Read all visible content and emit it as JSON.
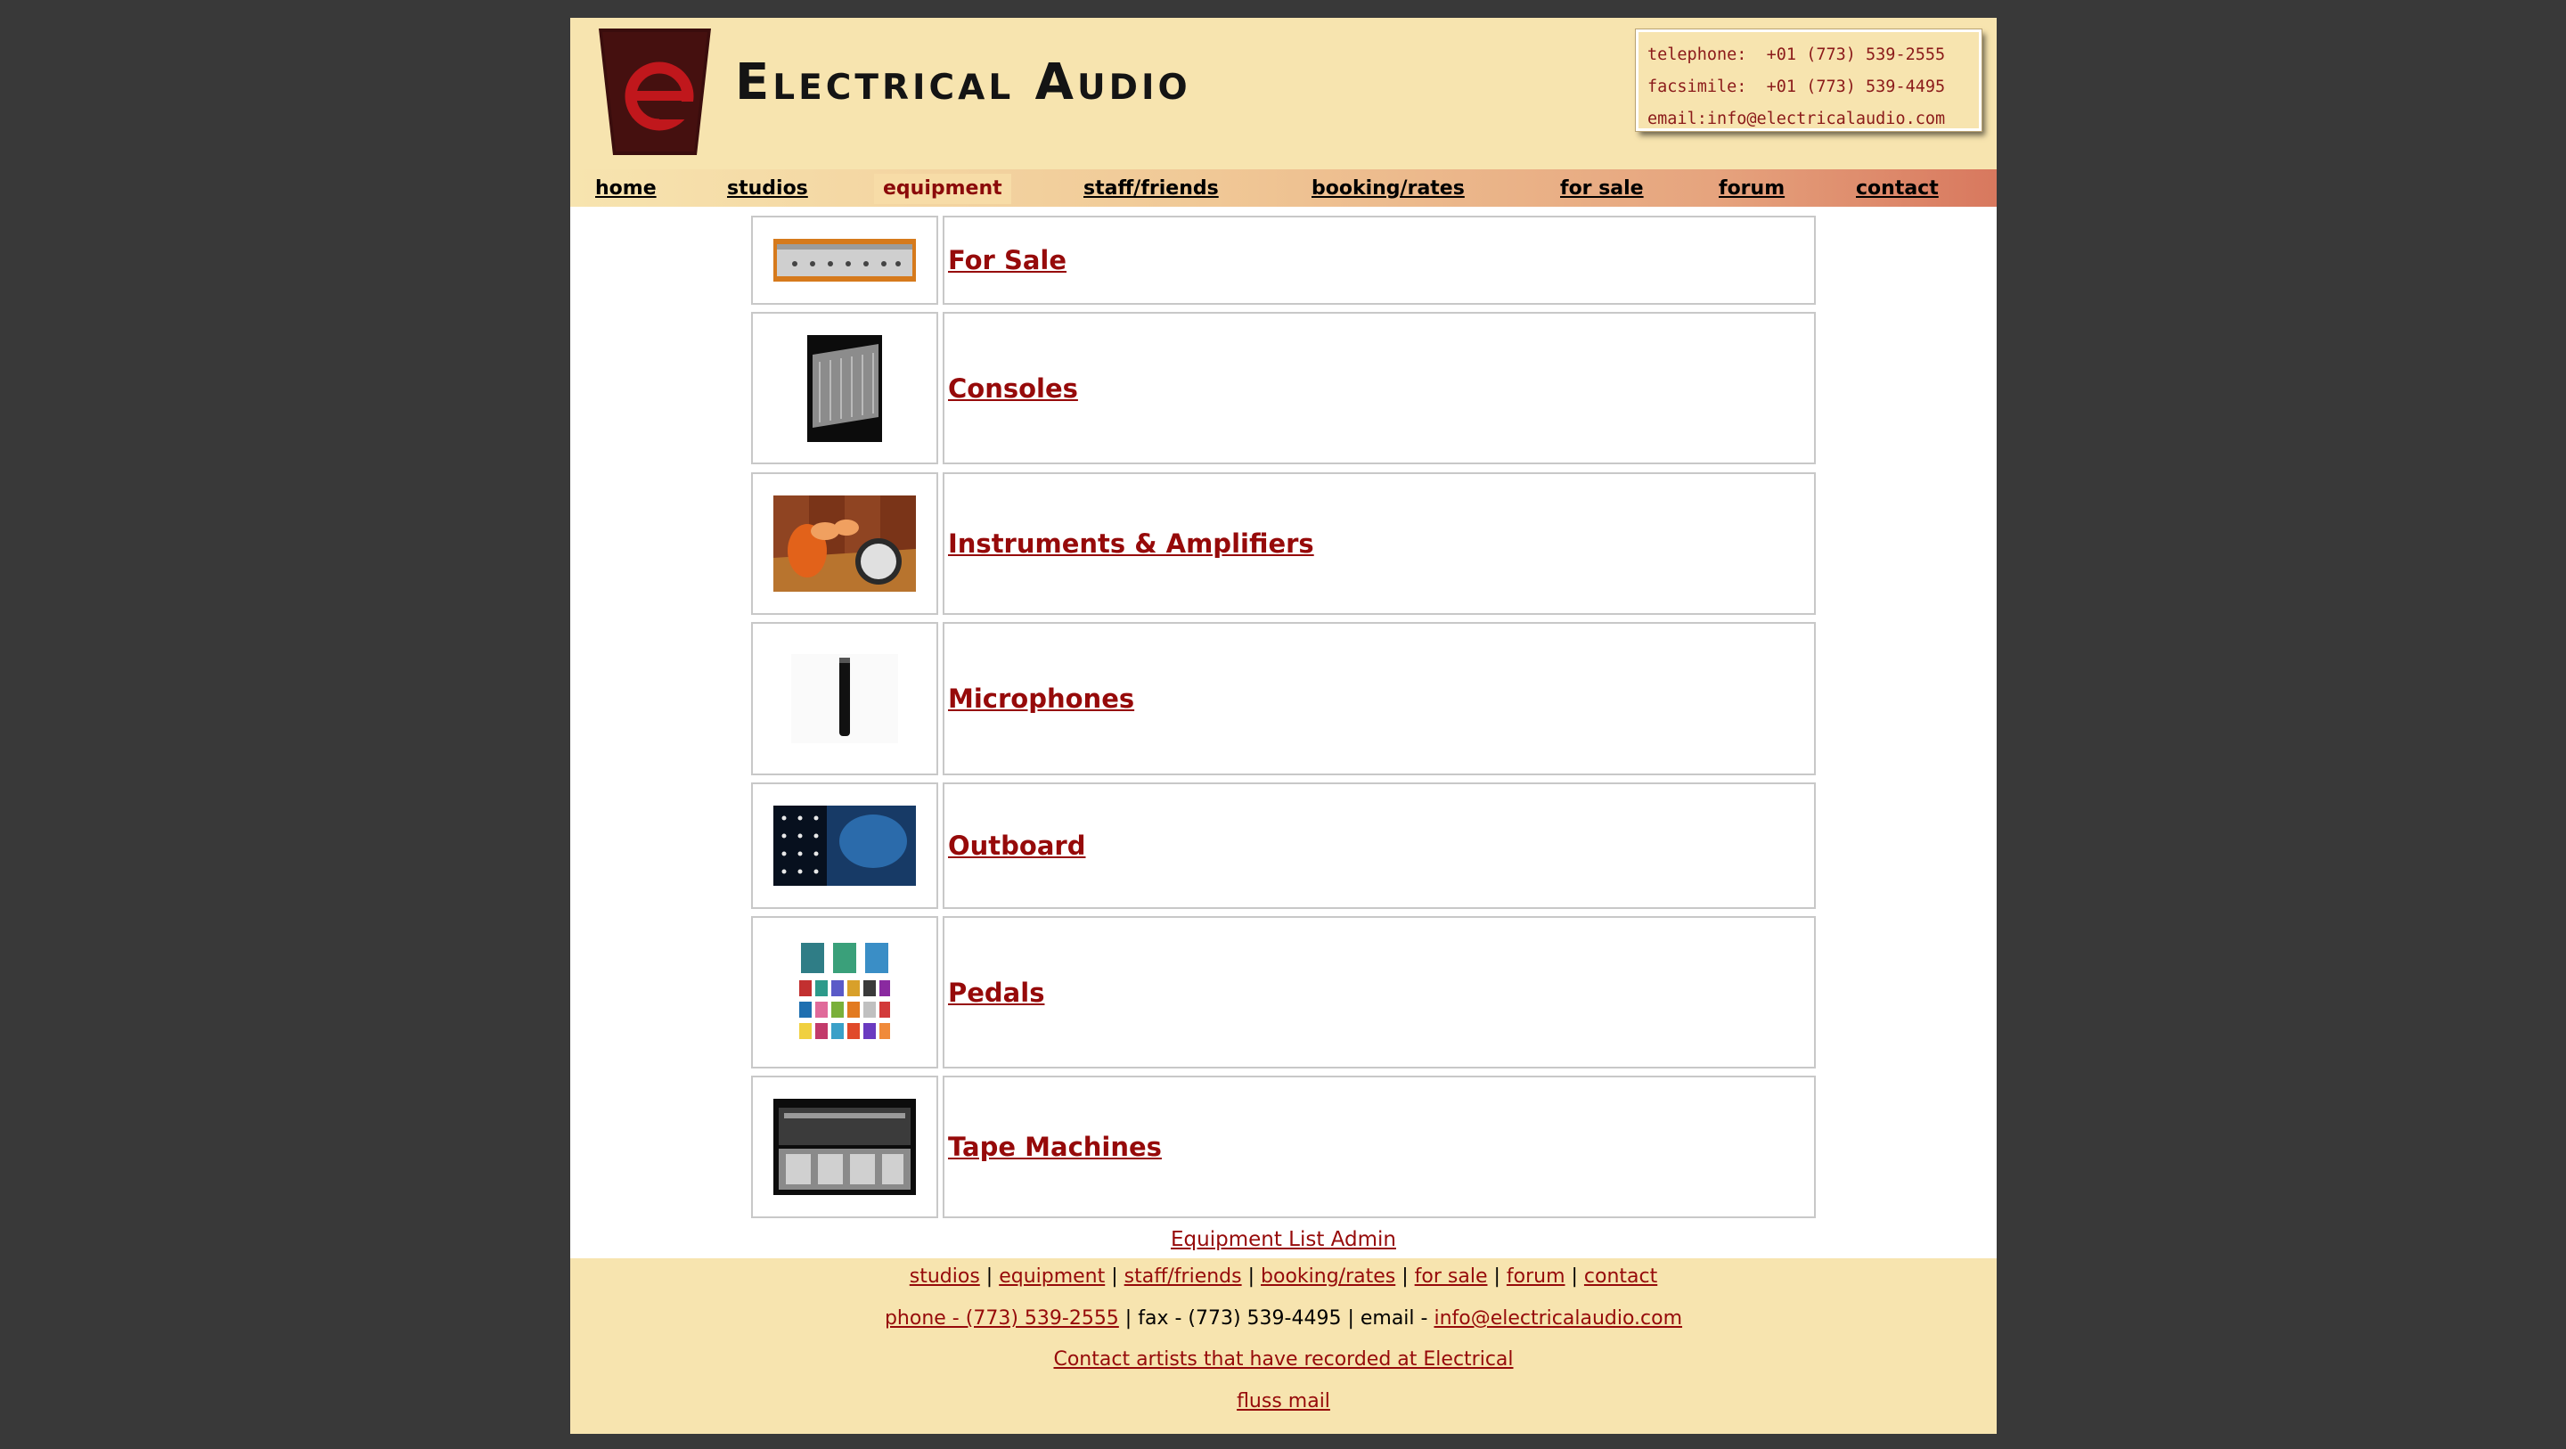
{
  "site": {
    "logo_title": "Electrical Audio",
    "logo_glyph": "e",
    "contact_box": {
      "telephone": "telephone:  +01 (773) 539-2555",
      "facsimile": "facsimile:  +01 (773) 539-4495",
      "email": "email:info@electricalaudio.com"
    }
  },
  "nav": {
    "items": [
      {
        "label": "home"
      },
      {
        "label": "studios"
      },
      {
        "label": "equipment",
        "active": true
      },
      {
        "label": "staff/friends"
      },
      {
        "label": "booking/rates"
      },
      {
        "label": "for sale"
      },
      {
        "label": "forum"
      },
      {
        "label": "contact"
      }
    ]
  },
  "categories": [
    {
      "label": "For Sale",
      "thumb": "rack-unit-thumbnail"
    },
    {
      "label": "Consoles",
      "thumb": "console-thumbnail"
    },
    {
      "label": "Instruments & Amplifiers",
      "thumb": "drum-kit-thumbnail"
    },
    {
      "label": "Microphones",
      "thumb": "microphone-thumbnail"
    },
    {
      "label": "Outboard",
      "thumb": "outboard-rack-thumbnail"
    },
    {
      "label": "Pedals",
      "thumb": "pedals-thumbnail"
    },
    {
      "label": "Tape Machines",
      "thumb": "tape-machine-thumbnail"
    }
  ],
  "admin_link": "Equipment List Admin",
  "footer": {
    "nav": [
      "studios",
      "equipment",
      "staff/friends",
      "booking/rates",
      "for sale",
      "forum",
      "contact"
    ],
    "separator": " | ",
    "phone_link": "phone - (773) 539-2555",
    "fax_text": " | fax - (773) 539-4495 | email - ",
    "email_link": "info@electricalaudio.com",
    "artists_link": "Contact artists that have recorded at Electrical",
    "fluss_link": "fluss mail"
  },
  "colors": {
    "background": "#393939",
    "header_bg": "#f7e4af",
    "link_red": "#960a0a",
    "logo_dark": "#3a0d0d",
    "logo_red": "#c0171c"
  }
}
